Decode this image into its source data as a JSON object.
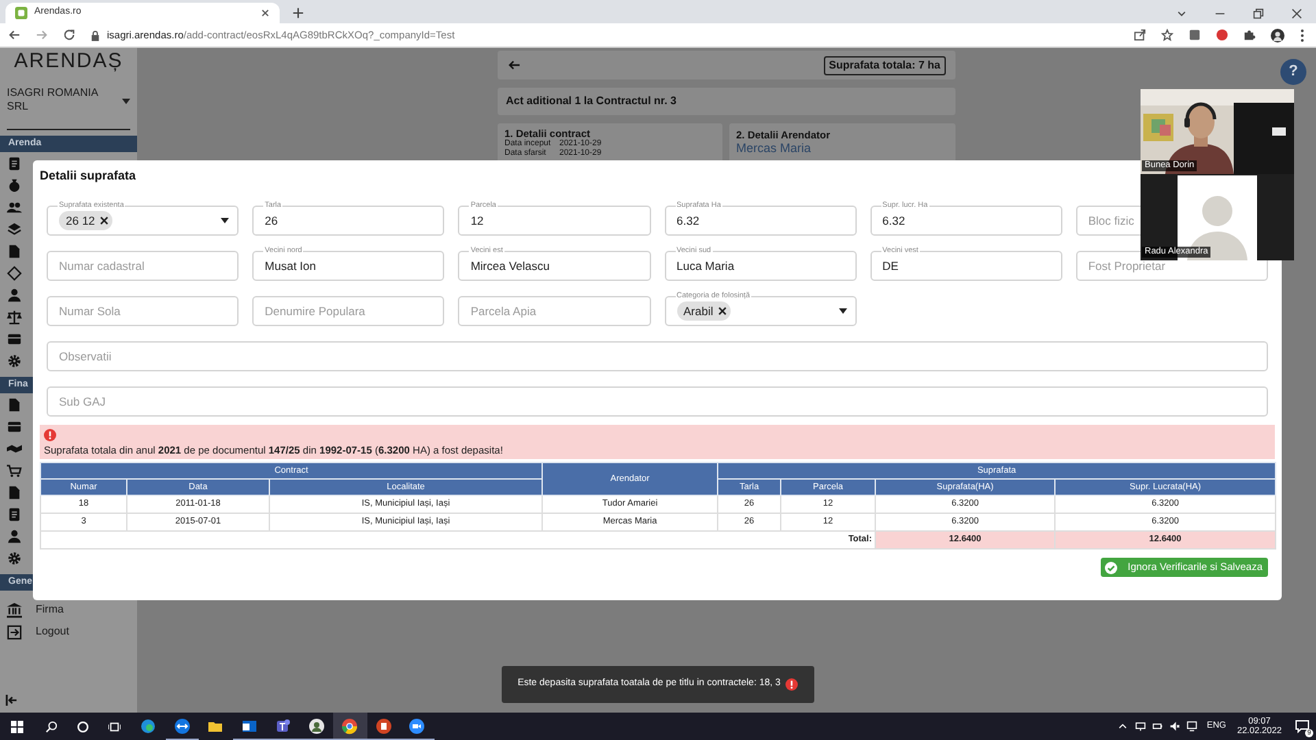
{
  "browser": {
    "tab_title": "Arendas.ro",
    "url_host": "isagri.arendas.ro",
    "url_path": "/add-contract/eosRxL4qAG89tbRCkXOq?_companyId=Test"
  },
  "sidebar": {
    "logo": "ARENDAȘ",
    "company": "ISAGRI ROMANIA SRL",
    "sections": [
      {
        "title": "Arenda"
      },
      {
        "title": "Fina"
      },
      {
        "title": "Gene"
      }
    ],
    "items": [
      {
        "label": "Firma"
      },
      {
        "label": "Logout"
      }
    ]
  },
  "page": {
    "total": "Suprafata totala: 7 ha",
    "act_title": "Act aditional 1 la Contractul nr. 3",
    "contract_card": {
      "title": "1. Detalii contract",
      "rows": [
        {
          "label": "Data inceput",
          "value": "2021-10-29"
        },
        {
          "label": "Data sfarsit",
          "value": "2021-10-29"
        }
      ]
    },
    "arendator_card": {
      "title": "2. Detalii Arendator",
      "name": "Mercas Maria"
    }
  },
  "help": "?",
  "modal": {
    "title": "Detalii suprafata",
    "field_rows": [
      [
        {
          "kind": "select",
          "label": "Suprafata existenta",
          "chips": [
            "26 12"
          ]
        },
        {
          "kind": "input",
          "label": "Tarla",
          "value": "26"
        },
        {
          "kind": "input",
          "label": "Parcela",
          "value": "12"
        },
        {
          "kind": "input",
          "label": "Suprafata Ha",
          "value": "6.32"
        },
        {
          "kind": "input",
          "label": "Supr. lucr. Ha",
          "value": "6.32"
        },
        {
          "kind": "input",
          "placeholder": "Bloc fizic"
        }
      ],
      [
        {
          "kind": "input",
          "placeholder": "Numar cadastral"
        },
        {
          "kind": "input",
          "label": "Vecini nord",
          "value": "Musat Ion"
        },
        {
          "kind": "input",
          "label": "Vecini est",
          "value": "Mircea Velascu"
        },
        {
          "kind": "input",
          "label": "Vecini sud",
          "value": "Luca Maria"
        },
        {
          "kind": "input",
          "label": "Vecini vest",
          "value": "DE"
        },
        {
          "kind": "input",
          "placeholder": "Fost Proprietar"
        }
      ],
      [
        {
          "kind": "input",
          "placeholder": "Numar Sola"
        },
        {
          "kind": "input",
          "placeholder": "Denumire Populara"
        },
        {
          "kind": "input",
          "placeholder": "Parcela Apia"
        },
        {
          "kind": "select",
          "label": "Categoria de folosință",
          "chips": [
            "Arabil"
          ]
        }
      ],
      [
        {
          "kind": "wide",
          "placeholder": "Observatii"
        }
      ],
      [
        {
          "kind": "wide",
          "placeholder": "Sub GAJ"
        }
      ]
    ],
    "alert": "Suprafata totala din anul **2021** de pe documentul **147/25** din **1992-07-15** (**6.3200** HA) a fost depasita!",
    "table": {
      "groups": [
        "Contract",
        "Suprafata"
      ],
      "columns": [
        "Numar",
        "Data",
        "Localitate",
        "Arendator",
        "Tarla",
        "Parcela",
        "Suprafata(HA)",
        "Supr. Lucrata(HA)"
      ],
      "rows": [
        [
          "18",
          "2011-01-18",
          "IS, Municipiul Iași, Iași",
          "Tudor Amariei",
          "26",
          "12",
          "6.3200",
          "6.3200"
        ],
        [
          "3",
          "2015-07-01",
          "IS, Municipiul Iași, Iași",
          "Mercas Maria",
          "26",
          "12",
          "6.3200",
          "6.3200"
        ]
      ],
      "total_label": "Total:",
      "totals": [
        "12.6400",
        "12.6400"
      ]
    },
    "button": "Ignora Verificarile si Salveaza"
  },
  "video": [
    {
      "kind": "camera",
      "name": "Bunea Dorin"
    },
    {
      "kind": "avatar",
      "name": "Radu Alexandra"
    }
  ],
  "toast": "Este depasita suprafata toatala de pe titlu in contractele: 18, 3",
  "taskbar": {
    "lang": "ENG",
    "time": "09:07",
    "date": "22.02.2022",
    "notifications": "9"
  }
}
